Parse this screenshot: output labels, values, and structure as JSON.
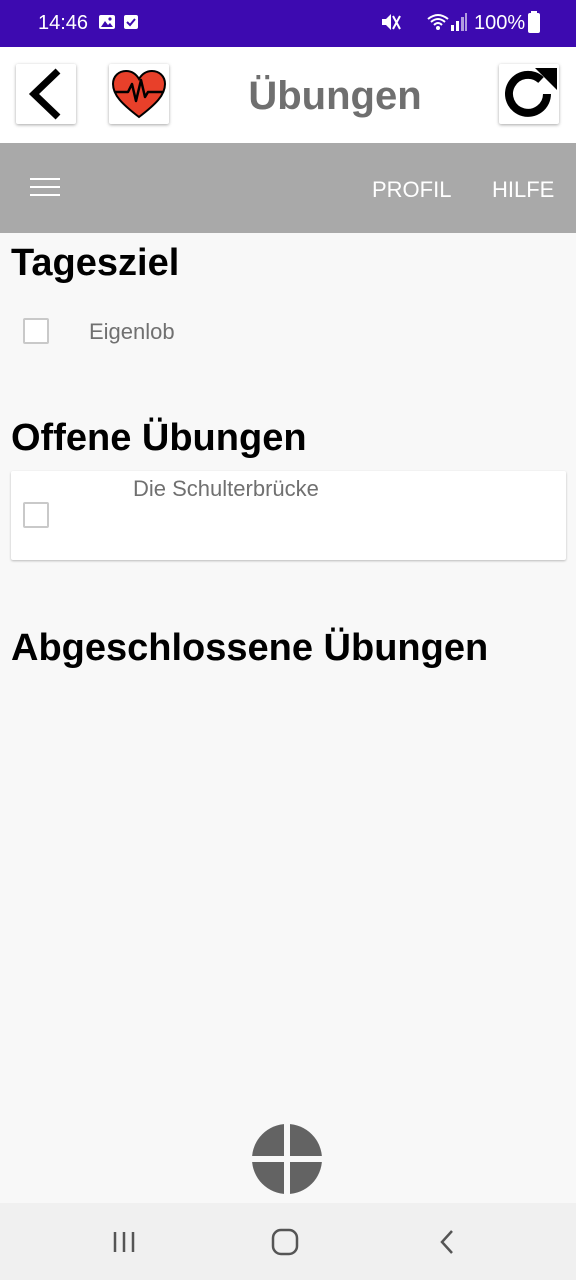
{
  "status_bar": {
    "time": "14:46",
    "battery": "100%",
    "icons": [
      "image-icon",
      "check-square-icon",
      "mute-icon",
      "wifi-icon",
      "signal-icon",
      "battery-icon"
    ]
  },
  "header": {
    "title": "Übungen",
    "back_icon": "back-arrow-icon",
    "heart_icon": "heart-pulse-icon",
    "refresh_icon": "refresh-icon"
  },
  "toolbar": {
    "menu_icon": "hamburger-menu-icon",
    "profile_label": "PROFIL",
    "help_label": "HILFE"
  },
  "sections": {
    "daily_goal": {
      "title": "Tagesziel",
      "items": [
        {
          "label": "Eigenlob",
          "checked": false
        }
      ]
    },
    "open_exercises": {
      "title": "Offene Übungen",
      "items": [
        {
          "label": "Die Schulterbrücke",
          "checked": false
        }
      ]
    },
    "completed_exercises": {
      "title": "Abgeschlossene Übungen",
      "items": []
    }
  },
  "fab": {
    "icon": "plus-icon"
  },
  "nav_bar": {
    "icons": [
      "recent-apps-icon",
      "home-icon",
      "back-icon"
    ]
  },
  "colors": {
    "status_bar": "#3d0ab0",
    "toolbar": "#a9a9a9",
    "heart": "#e8402a",
    "fab": "#636363",
    "background": "#f8f8f8"
  }
}
